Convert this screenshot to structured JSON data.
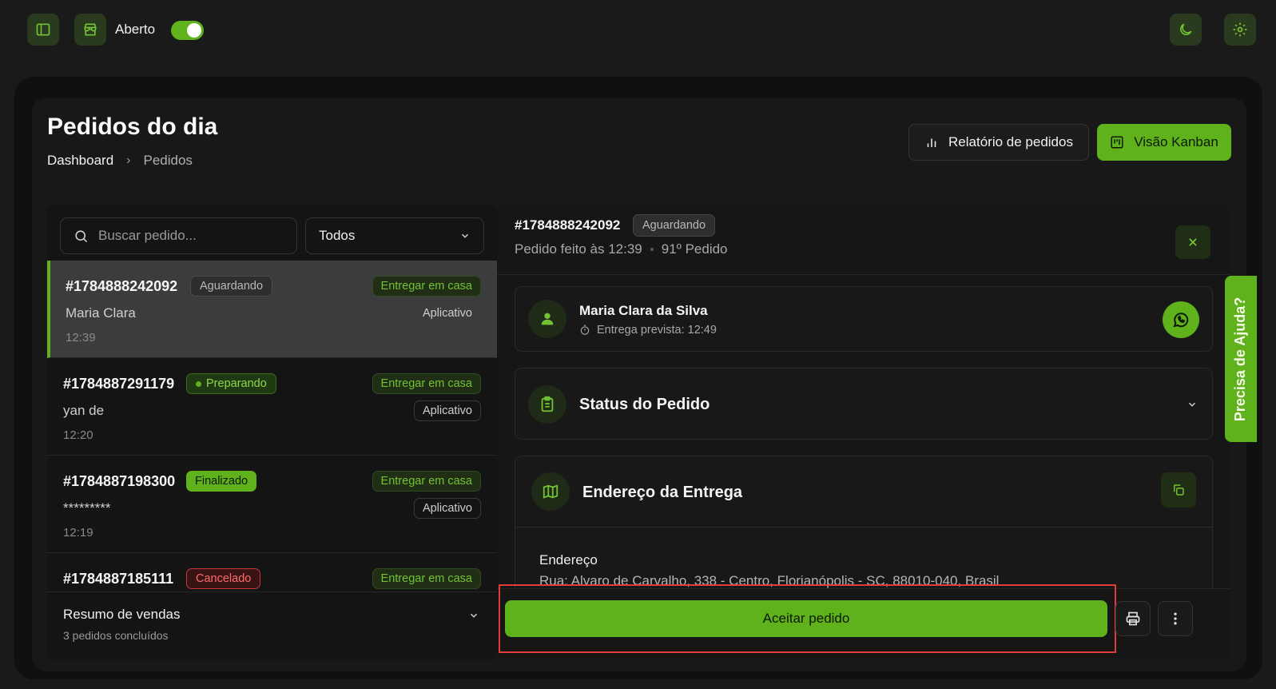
{
  "topbar": {
    "status_label": "Aberto",
    "status_on": true
  },
  "page": {
    "title": "Pedidos do dia",
    "breadcrumb": [
      "Dashboard",
      "Pedidos"
    ]
  },
  "actions": {
    "report_label": "Relatório de pedidos",
    "kanban_label": "Visão Kanban"
  },
  "list": {
    "search_placeholder": "Buscar pedido...",
    "filter_value": "Todos",
    "orders": [
      {
        "id": "#1784888242092",
        "status": "Aguardando",
        "delivery": "Entregar em casa",
        "channel": "Aplicativo",
        "customer": "Maria Clara",
        "time": "12:39"
      },
      {
        "id": "#1784887291179",
        "status": "Preparando",
        "delivery": "Entregar em casa",
        "channel": "Aplicativo",
        "customer": "yan de",
        "time": "12:20"
      },
      {
        "id": "#1784887198300",
        "status": "Finalizado",
        "delivery": "Entregar em casa",
        "channel": "Aplicativo",
        "customer": "*********",
        "time": "12:19"
      },
      {
        "id": "#1784887185111",
        "status": "Cancelado",
        "delivery": "Entregar em casa",
        "channel": "",
        "customer": "",
        "time": ""
      }
    ],
    "summary": {
      "title": "Resumo de vendas",
      "subtitle": "3 pedidos concluídos"
    }
  },
  "detail": {
    "id": "#1784888242092",
    "status": "Aguardando",
    "placed_at": "Pedido feito às 12:39",
    "order_rank": "91º Pedido",
    "customer": {
      "name": "Maria Clara da Silva",
      "eta": "Entrega prevista: 12:49"
    },
    "status_section": "Status do Pedido",
    "address_section": "Endereço da Entrega",
    "address_label": "Endereço",
    "address_value": "Rua: Alvaro de Carvalho, 338 - Centro, Florianópolis - SC, 88010-040, Brasil",
    "accept_label": "Aceitar pedido"
  },
  "help_label": "Precisa de Ajuda?",
  "colors": {
    "accent": "#5fb21b",
    "background": "#1a1a1a",
    "danger": "#e03c3c"
  }
}
